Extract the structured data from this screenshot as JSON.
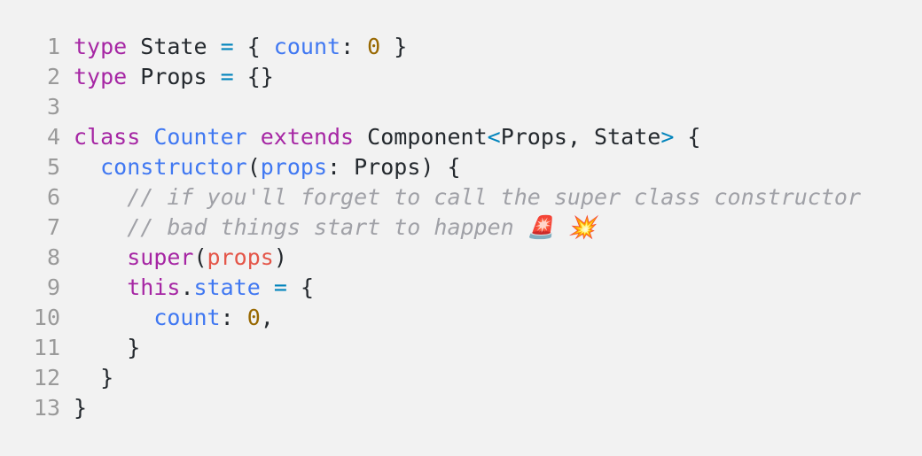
{
  "editor": {
    "lines": [
      {
        "n": "1",
        "t": [
          [
            "kw",
            "type"
          ],
          [
            "plain",
            " State "
          ],
          [
            "op",
            "="
          ],
          [
            "plain",
            " { "
          ],
          [
            "ty",
            "count"
          ],
          [
            "plain",
            ": "
          ],
          [
            "num",
            "0"
          ],
          [
            "plain",
            " }"
          ]
        ]
      },
      {
        "n": "2",
        "t": [
          [
            "kw",
            "type"
          ],
          [
            "plain",
            " Props "
          ],
          [
            "op",
            "="
          ],
          [
            "plain",
            " {}"
          ]
        ]
      },
      {
        "n": "3",
        "t": []
      },
      {
        "n": "4",
        "t": [
          [
            "kw",
            "class"
          ],
          [
            "plain",
            " "
          ],
          [
            "ty",
            "Counter"
          ],
          [
            "plain",
            " "
          ],
          [
            "kw",
            "extends"
          ],
          [
            "plain",
            " Component"
          ],
          [
            "op",
            "<"
          ],
          [
            "plain",
            "Props, State"
          ],
          [
            "op",
            ">"
          ],
          [
            "plain",
            " {"
          ]
        ]
      },
      {
        "n": "5",
        "t": [
          [
            "plain",
            "  "
          ],
          [
            "fn",
            "constructor"
          ],
          [
            "plain",
            "("
          ],
          [
            "ty",
            "props"
          ],
          [
            "plain",
            ": Props) {"
          ]
        ]
      },
      {
        "n": "6",
        "t": [
          [
            "plain",
            "    "
          ],
          [
            "cm",
            "// if you'll forget to call the super class constructor"
          ]
        ]
      },
      {
        "n": "7",
        "t": [
          [
            "plain",
            "    "
          ],
          [
            "cm",
            "// bad things start to happen 🚨 💥"
          ]
        ]
      },
      {
        "n": "8",
        "t": [
          [
            "plain",
            "    "
          ],
          [
            "kw",
            "super"
          ],
          [
            "plain",
            "("
          ],
          [
            "param",
            "props"
          ],
          [
            "plain",
            ")"
          ]
        ]
      },
      {
        "n": "9",
        "t": [
          [
            "plain",
            "    "
          ],
          [
            "kw",
            "this"
          ],
          [
            "plain",
            "."
          ],
          [
            "ty",
            "state"
          ],
          [
            "plain",
            " "
          ],
          [
            "op",
            "="
          ],
          [
            "plain",
            " {"
          ]
        ]
      },
      {
        "n": "10",
        "t": [
          [
            "plain",
            "      "
          ],
          [
            "ty",
            "count"
          ],
          [
            "plain",
            ": "
          ],
          [
            "num",
            "0"
          ],
          [
            "plain",
            ","
          ]
        ]
      },
      {
        "n": "11",
        "t": [
          [
            "plain",
            "    }"
          ]
        ]
      },
      {
        "n": "12",
        "t": [
          [
            "plain",
            "  }"
          ]
        ]
      },
      {
        "n": "13",
        "t": [
          [
            "plain",
            "}"
          ]
        ]
      }
    ]
  },
  "colors": {
    "background": "#f2f2f2",
    "keyword": "#a626a4",
    "type": "#4078f2",
    "operator": "#0184bc",
    "number": "#986801",
    "parameter": "#e45649",
    "comment": "#a0a1a7",
    "line_number": "#9a9a9a"
  }
}
